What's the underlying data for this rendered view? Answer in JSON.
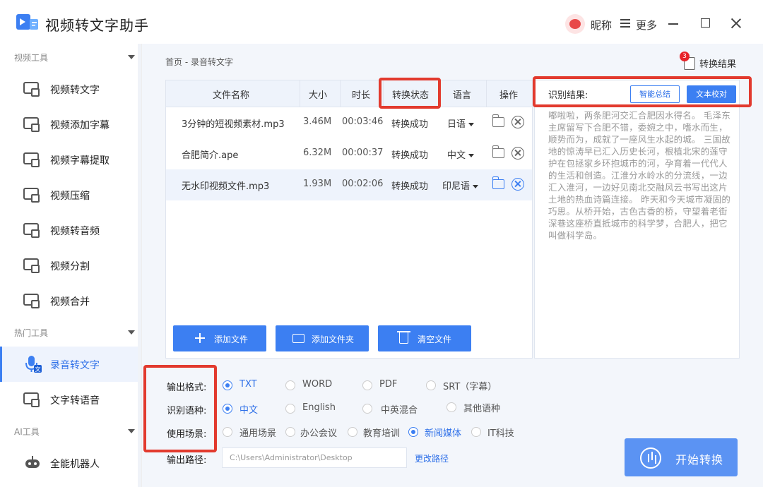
{
  "app": {
    "title": "视频转文字助手",
    "nickname": "昵称",
    "more": "更多"
  },
  "sidebar": {
    "sections": [
      {
        "title": "视频工具"
      },
      {
        "title": "热门工具"
      },
      {
        "title": "AI工具"
      }
    ],
    "items": [
      {
        "label": "视频转文字",
        "icon": "video-text-icon"
      },
      {
        "label": "视频添加字幕",
        "icon": "video-subtitle-add-icon"
      },
      {
        "label": "视频字幕提取",
        "icon": "subtitle-extract-icon"
      },
      {
        "label": "视频压缩",
        "icon": "video-compress-icon"
      },
      {
        "label": "视频转音频",
        "icon": "video-audio-icon"
      },
      {
        "label": "视频分割",
        "icon": "video-split-icon"
      },
      {
        "label": "视频合并",
        "icon": "video-merge-icon"
      },
      {
        "label": "录音转文字",
        "icon": "audio-text-icon",
        "active": true
      },
      {
        "label": "文字转语音",
        "icon": "text-speech-icon"
      },
      {
        "label": "全能机器人",
        "icon": "robot-icon"
      }
    ]
  },
  "breadcrumb": "首页 - 录音转文字",
  "result_link": {
    "label": "转换结果",
    "badge": "3"
  },
  "table": {
    "headers": [
      "文件名称",
      "大小",
      "时长",
      "转换状态",
      "语言",
      "操作"
    ],
    "rows": [
      {
        "name": "3分钟的短视频素材.mp3",
        "size": "3.46M",
        "duration": "00:03:46",
        "status": "转换成功",
        "lang": "日语"
      },
      {
        "name": "合肥简介.ape",
        "size": "6.32M",
        "duration": "00:00:37",
        "status": "转换成功",
        "lang": "中文"
      },
      {
        "name": "无水印视频文件.mp3",
        "size": "1.93M",
        "duration": "00:02:06",
        "status": "转换成功",
        "lang": "印尼语"
      }
    ]
  },
  "buttons": {
    "add_file": "添加文件",
    "add_folder": "添加文件夹",
    "clear_files": "清空文件",
    "start": "开始转换",
    "change_path": "更改路径"
  },
  "result": {
    "label": "识别结果:",
    "summary_btn": "智能总结",
    "proofread_btn": "文本校对",
    "text": "嘟啦啦，两条肥河交汇合肥因水得名。 毛泽东主席留写下合肥不错，委婉之中，嗜水而生，顺势而为，成就了一座风生水起的城。 三国故地的惊涛早已汇入历史长河，根植北宋的莲守护在包拯家乡环抱城市的河，孕育着一代代人的生活和创造。江淮分水岭水的分流线，一边汇入淮河，一边好见南北交融风云书写出这片土地的热血诗篇连接。 昨天和今天城市凝固的巧思。从桥开始，古色古香的桥，守望着老街深巷这座桥直抵城市的科学梦，合肥人，把它叫做科学岛。"
  },
  "options": {
    "format": {
      "label": "输出格式:",
      "choices": [
        "TXT",
        "WORD",
        "PDF",
        "SRT（字幕）"
      ],
      "selected": "TXT"
    },
    "language": {
      "label": "识别语种:",
      "choices": [
        "中文",
        "English",
        "中英混合",
        "其他语种"
      ],
      "selected": "中文"
    },
    "scene": {
      "label": "使用场景:",
      "choices": [
        "通用场景",
        "办公会议",
        "教育培训",
        "新闻媒体",
        "IT科技"
      ],
      "selected": "新闻媒体"
    },
    "path": {
      "label": "输出路径:",
      "value": "C:\\Users\\Administrator\\Desktop"
    }
  },
  "colors": {
    "accent": "#3c7ff2",
    "highlight": "#e23a2e",
    "main_bg": "#f3f6fb"
  }
}
